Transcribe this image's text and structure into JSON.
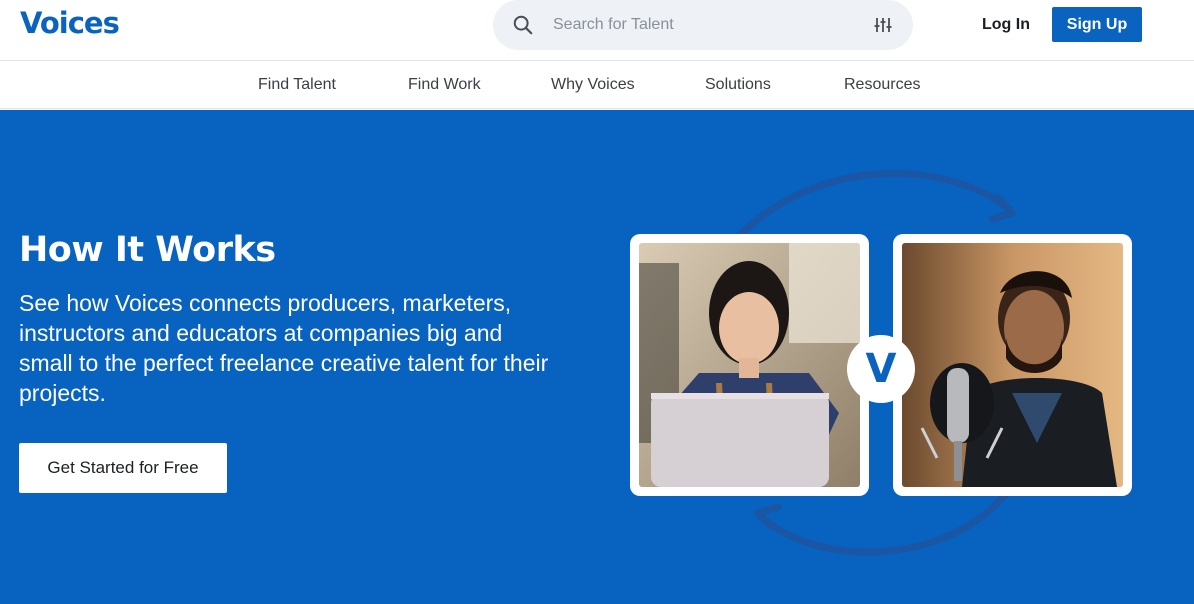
{
  "brand": {
    "logo_text": "Voices",
    "accent": "#0a63bf",
    "hero_bg": "#0762c0"
  },
  "search": {
    "placeholder": "Search for Talent",
    "icon": "search-icon",
    "filter_icon": "sliders-icon"
  },
  "auth": {
    "login_label": "Log In",
    "signup_label": "Sign Up"
  },
  "nav": {
    "items": [
      {
        "label": "Find Talent"
      },
      {
        "label": "Find Work"
      },
      {
        "label": "Why Voices"
      },
      {
        "label": "Solutions"
      },
      {
        "label": "Resources"
      }
    ]
  },
  "hero": {
    "title": "How It Works",
    "description": "See how Voices connects producers, marketers, instructors and educators at companies big and small to the perfect freelance creative talent for their projects.",
    "cta_label": "Get Started for Free",
    "badge_letter": "V"
  }
}
